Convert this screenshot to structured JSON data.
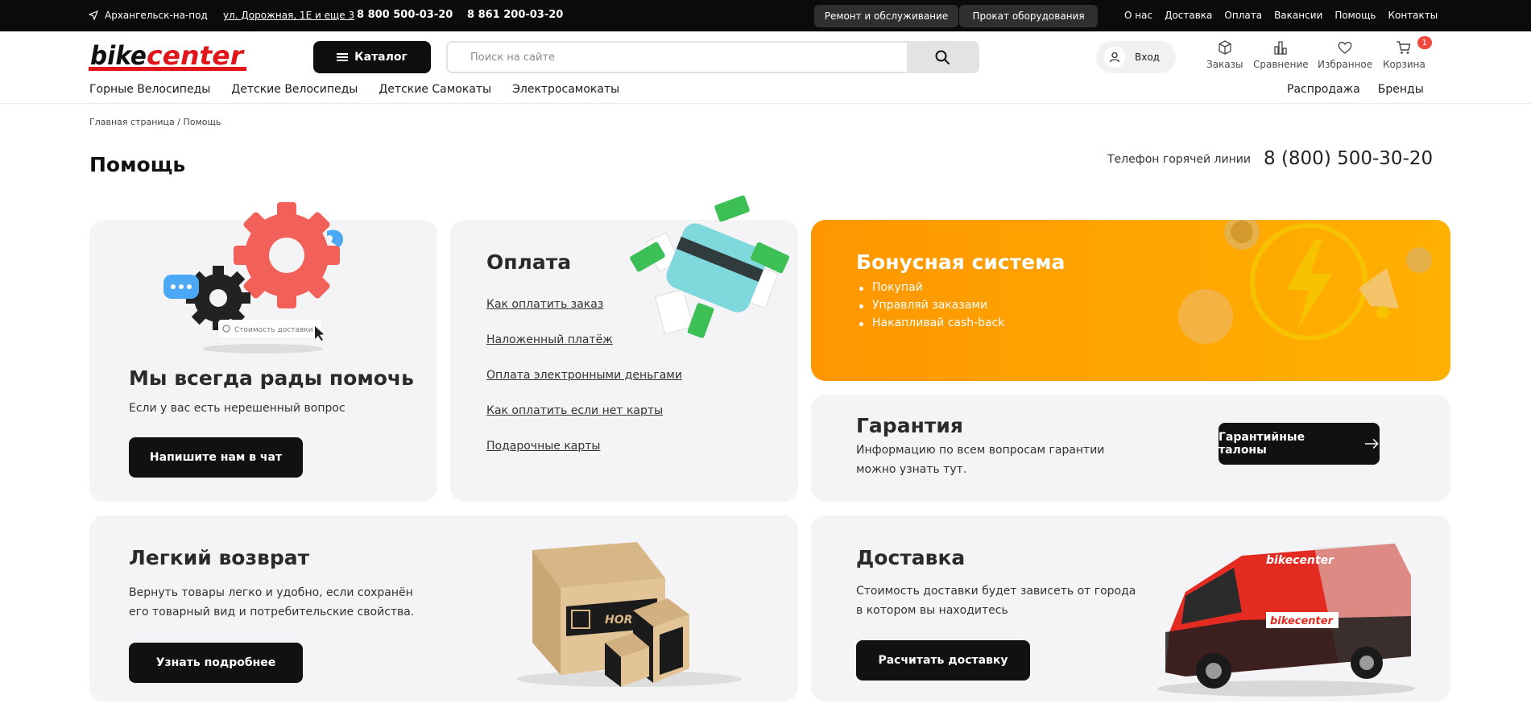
{
  "topbar": {
    "city": "Архангельск-на-под",
    "address": "ул. Дорожная, 1Е и еще 3",
    "phone1": "8 800 500-03-20",
    "phone2": "8 861 200-03-20",
    "service_btn": "Ремонт и обслуживание",
    "rent_btn": "Прокат оборудования",
    "links": [
      "О нас",
      "Доставка",
      "Оплата",
      "Вакансии",
      "Помощь",
      "Контакты"
    ]
  },
  "header": {
    "logo_text": "bikecenter",
    "catalog_label": "Каталог",
    "search_placeholder": "Поиск на сайте",
    "login_label": "Вход",
    "orders_label": "Заказы",
    "compare_label": "Сравнение",
    "favorites_label": "Избранное",
    "cart_label": "Корзина",
    "cart_count": "1",
    "nav": [
      "Горные Велосипеды",
      "Детские Велосипеды",
      "Детские Самокаты",
      "Электросамокаты"
    ],
    "nav_right": [
      "Распродажа",
      "Бренды"
    ]
  },
  "breadcrumb": "Главная страница / Помощь",
  "page_title": "Помощь",
  "hotline_label": "Телефон горячей линии",
  "hotline_phone": "8 (800) 500-30-20",
  "help_card": {
    "illustration_text": "Стоимость доставки",
    "title": "Мы всегда рады помочь",
    "text": "Если у вас есть нерешенный вопрос",
    "button": "Напишите нам в чат"
  },
  "payment_card": {
    "title": "Оплата",
    "links": [
      "Как оплатить заказ",
      "Наложенный платёж",
      "Оплата электронными деньгами",
      "Как оплатить если нет карты",
      "Подарочные карты"
    ]
  },
  "bonus_card": {
    "title": "Бонусная система",
    "items": [
      "Покупай",
      "Управляй заказами",
      "Накапливай cash-back"
    ]
  },
  "warranty_card": {
    "title": "Гарантия",
    "text": "Информацию по всем вопросам гарантии можно узнать тут.",
    "button": "Гарантийные талоны"
  },
  "return_card": {
    "title": "Легкий возврат",
    "text": "Вернуть товары легко и удобно, если сохранён его товарный вид и потребительские свойства.",
    "button": "Узнать подробнее",
    "box_brand": "HORH"
  },
  "delivery_card": {
    "title": "Доставка",
    "text": "Стоимость доставки будет зависеть от города в котором вы находитесь",
    "button": "Расчитать доставку",
    "van_logo": "bikecenter"
  },
  "colors": {
    "accent_orange": "#ff9a00",
    "dark": "#0e0e0e",
    "card_bg": "#f4f3f6",
    "badge_red": "#f0473e",
    "logo_red": "#e0161b"
  }
}
